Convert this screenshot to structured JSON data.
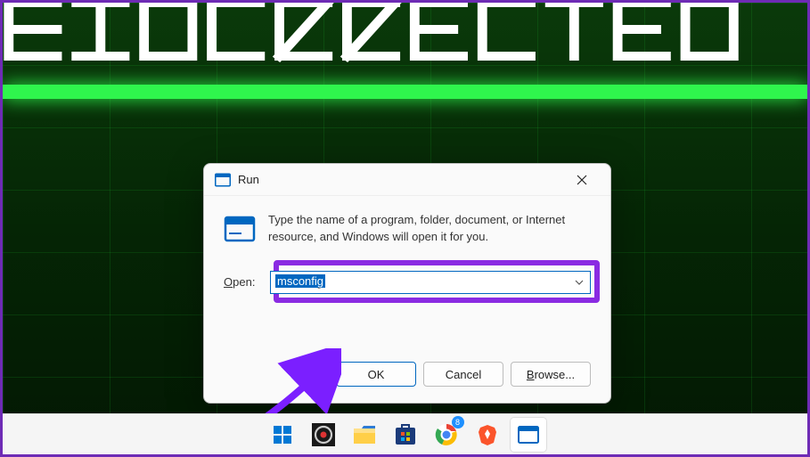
{
  "desktop": {
    "background_text": "DISCONNECTED"
  },
  "run_dialog": {
    "title": "Run",
    "description": "Type the name of a program, folder, document, or Internet resource, and Windows will open it for you.",
    "open_label": "Open:",
    "input_value": "msconfig",
    "buttons": {
      "ok": "OK",
      "cancel": "Cancel",
      "browse": "Browse..."
    }
  },
  "taskbar": {
    "chrome_badge": "8"
  },
  "colors": {
    "accent_blue": "#0067c0",
    "highlight_purple": "#8a2be2",
    "annotation_purple": "#7b1fff",
    "green_bar": "#2ff54d"
  }
}
